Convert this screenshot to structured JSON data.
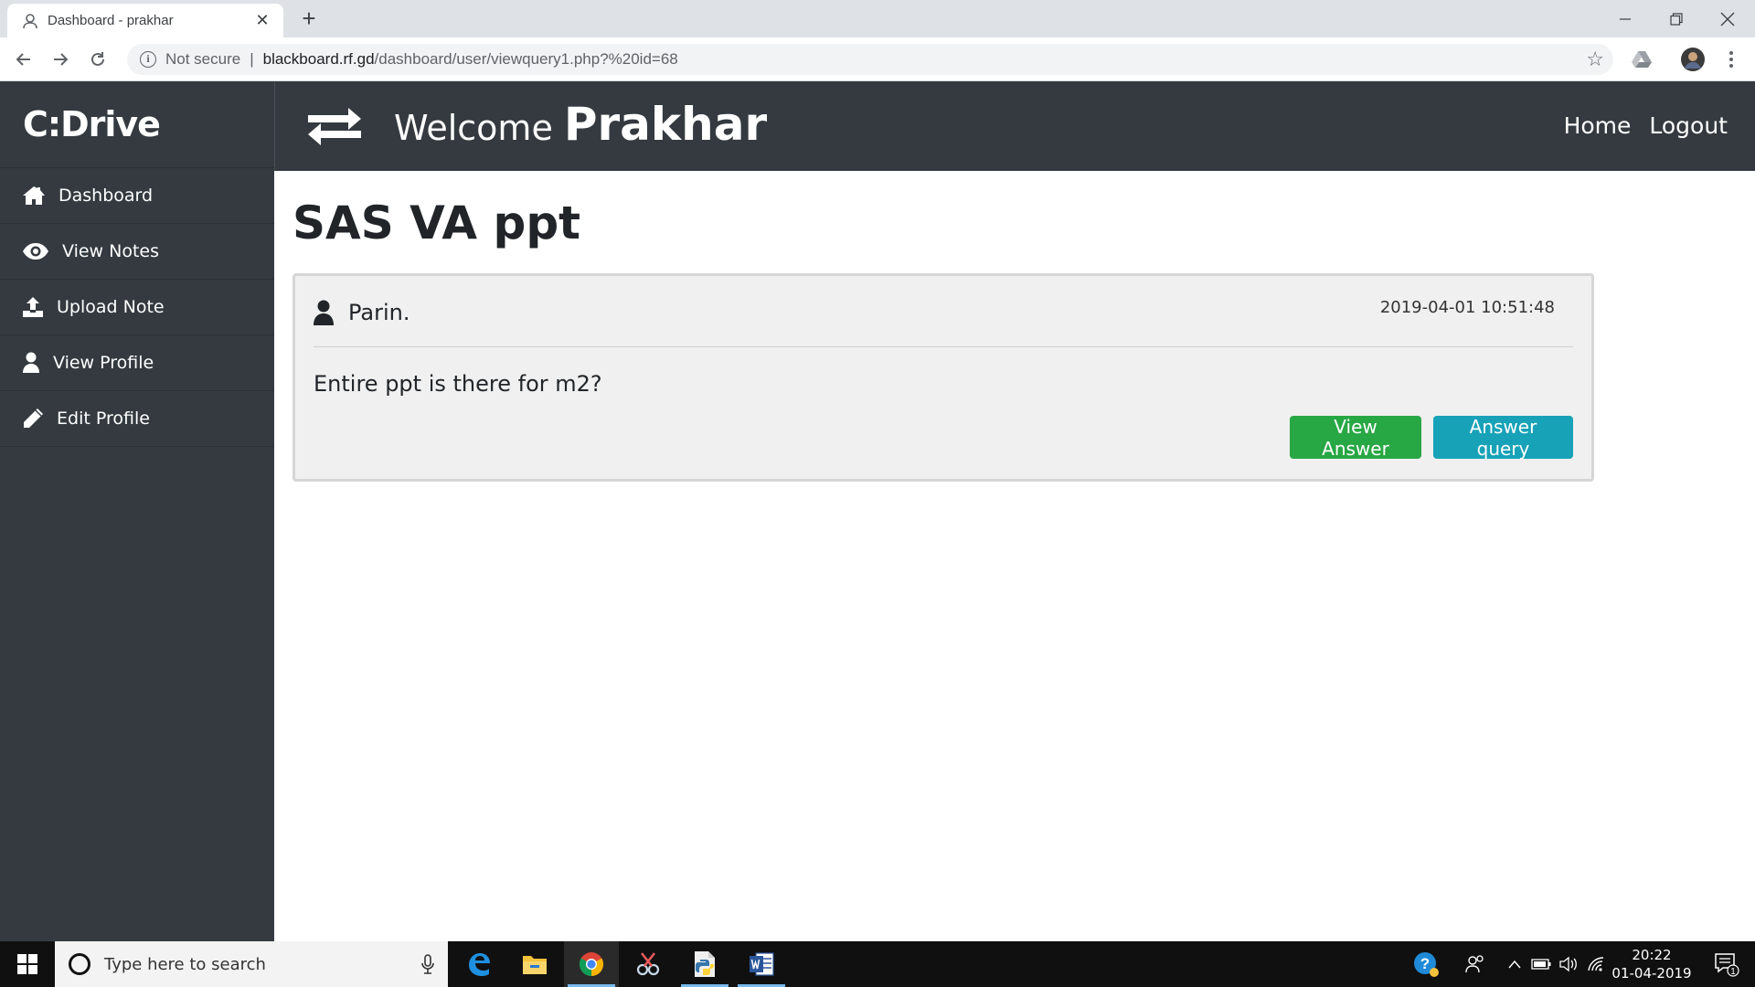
{
  "browser": {
    "tab_title": "Dashboard - prakhar",
    "new_tab_symbol": "+",
    "address_security": "Not secure",
    "address_separator": "|",
    "address_host": "blackboard.rf.gd",
    "address_path": "/dashboard/user/viewquery1.php?%20id=68"
  },
  "sidebar": {
    "brand": "C:Drive",
    "items": [
      {
        "label": "Dashboard",
        "icon": "home-icon"
      },
      {
        "label": "View Notes",
        "icon": "eye-icon"
      },
      {
        "label": "Upload Note",
        "icon": "upload-icon"
      },
      {
        "label": "View Profile",
        "icon": "user-icon"
      },
      {
        "label": "Edit Profile",
        "icon": "pencil-icon"
      }
    ]
  },
  "topnav": {
    "welcome": "Welcome",
    "user_name": "Prakhar",
    "links": [
      "Home",
      "Logout"
    ]
  },
  "main": {
    "title": "SAS VA ppt",
    "query": {
      "author": "Parin.",
      "timestamp": "2019-04-01 10:51:48",
      "text": "Entire ppt is there for m2?",
      "view_answer_label": "View Answer",
      "answer_query_label": "Answer query"
    }
  },
  "taskbar": {
    "search_placeholder": "Type here to search",
    "time": "20:22",
    "date": "01-04-2019",
    "notification_count": "1"
  },
  "colors": {
    "dark": "#343a40",
    "green": "#28a745",
    "teal": "#17a2b8"
  }
}
